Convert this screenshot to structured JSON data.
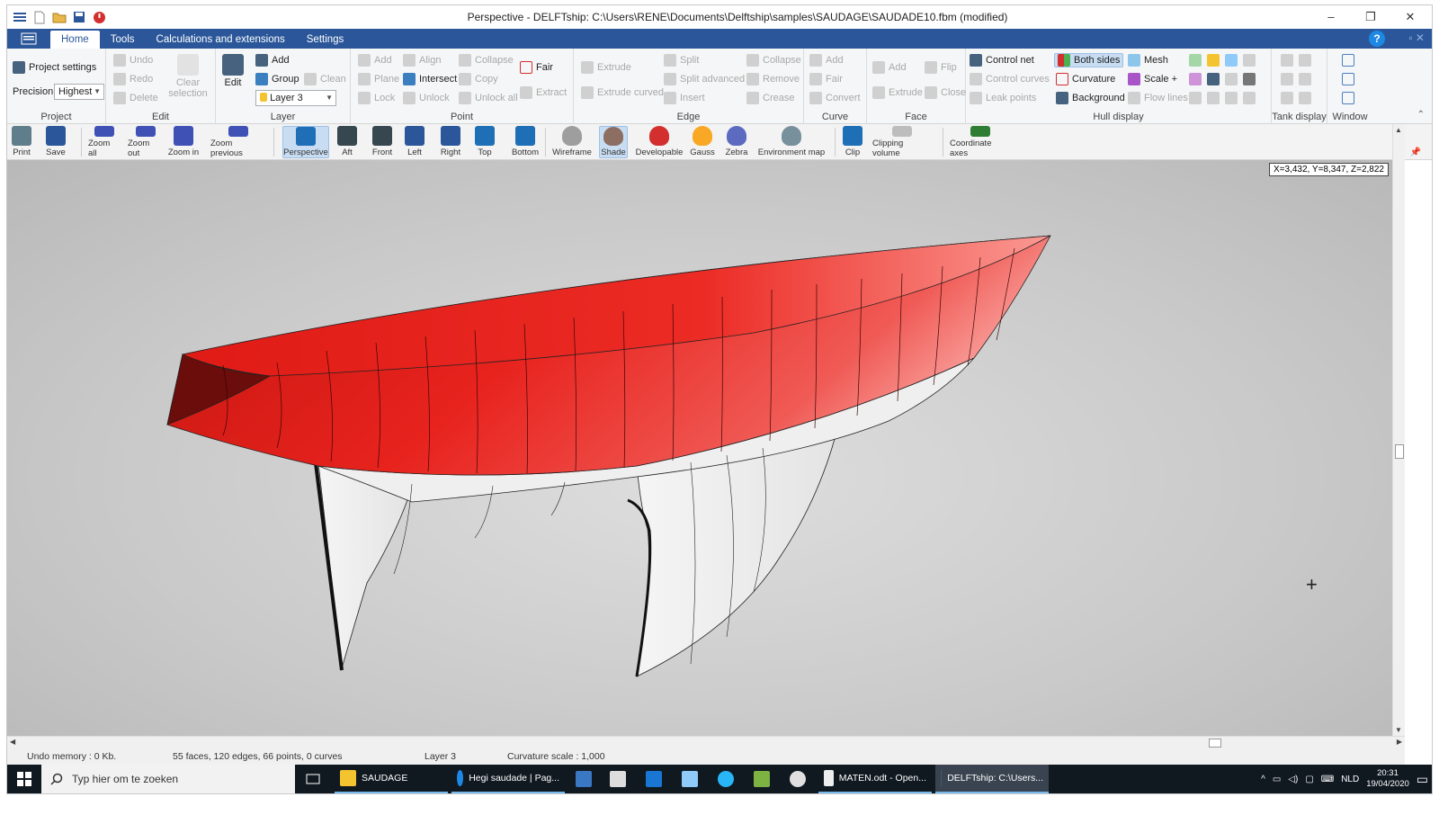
{
  "window": {
    "title": "Perspective - DELFTship: C:\\Users\\RENE\\Documents\\Delftship\\samples\\SAUDAGE\\SAUDADE10.fbm (modified)",
    "minimize": "–",
    "restore": "❐",
    "close": "✕"
  },
  "tabs": [
    "Home",
    "Tools",
    "Calculations and extensions",
    "Settings"
  ],
  "ribbon": {
    "project": {
      "label": "Project",
      "project_settings": "Project settings",
      "precision_label": "Precision",
      "precision_value": "Highest"
    },
    "edit": {
      "label": "Edit",
      "undo": "Undo",
      "redo": "Redo",
      "delete": "Delete",
      "clear_selection": "Clear selection"
    },
    "layer": {
      "label": "Layer",
      "edit": "Edit",
      "add": "Add",
      "group": "Group",
      "clean": "Clean",
      "current_layer": "Layer 3"
    },
    "point": {
      "label": "Point",
      "add": "Add",
      "align": "Align",
      "collapse": "Collapse",
      "fair": "Fair",
      "plane": "Plane",
      "intersect": "Intersect",
      "copy": "Copy",
      "lock": "Lock",
      "unlock": "Unlock",
      "unlock_all": "Unlock all",
      "extract": "Extract"
    },
    "edge": {
      "label": "Edge",
      "extrude": "Extrude",
      "split": "Split",
      "collapse": "Collapse",
      "split_advanced": "Split advanced",
      "remove": "Remove",
      "extrude_curved": "Extrude curved",
      "insert": "Insert",
      "crease": "Crease"
    },
    "curve": {
      "label": "Curve",
      "add": "Add",
      "fair": "Fair",
      "convert": "Convert"
    },
    "face": {
      "label": "Face",
      "add": "Add",
      "flip": "Flip",
      "extrude": "Extrude",
      "close": "Close"
    },
    "hull_display": {
      "label": "Hull display",
      "control_net": "Control net",
      "both_sides": "Both sides",
      "mesh": "Mesh",
      "control_curves": "Control curves",
      "curvature": "Curvature",
      "scale_plus": "Scale +",
      "leak_points": "Leak points",
      "background": "Background",
      "flow_lines": "Flow lines"
    },
    "tank_display": {
      "label": "Tank display"
    },
    "window_group": {
      "label": "Window"
    }
  },
  "viewbar": [
    {
      "label": "Print",
      "icon": "printer-icon"
    },
    {
      "label": "Save",
      "icon": "save-icon"
    },
    {
      "label": "Zoom all",
      "icon": "zoom-all-icon"
    },
    {
      "label": "Zoom out",
      "icon": "zoom-out-icon"
    },
    {
      "label": "Zoom in",
      "icon": "zoom-in-icon"
    },
    {
      "label": "Zoom previous",
      "icon": "zoom-previous-icon"
    },
    {
      "label": "Perspective",
      "icon": "perspective-icon"
    },
    {
      "label": "Aft",
      "icon": "aft-view-icon"
    },
    {
      "label": "Front",
      "icon": "front-view-icon"
    },
    {
      "label": "Left",
      "icon": "left-view-icon"
    },
    {
      "label": "Right",
      "icon": "right-view-icon"
    },
    {
      "label": "Top",
      "icon": "top-view-icon"
    },
    {
      "label": "Bottom",
      "icon": "bottom-view-icon"
    },
    {
      "label": "Wireframe",
      "icon": "wireframe-icon"
    },
    {
      "label": "Shade",
      "icon": "shade-icon"
    },
    {
      "label": "Developable",
      "icon": "developable-icon"
    },
    {
      "label": "Gauss",
      "icon": "gauss-icon"
    },
    {
      "label": "Zebra",
      "icon": "zebra-icon"
    },
    {
      "label": "Environment map",
      "icon": "environment-map-icon"
    },
    {
      "label": "Clip",
      "icon": "clip-icon"
    },
    {
      "label": "Clipping volume",
      "icon": "clipping-volume-icon"
    },
    {
      "label": "Coordinate axes",
      "icon": "coordinate-axes-icon"
    }
  ],
  "viewport": {
    "coordinates": "X=3,432, Y=8,347, Z=2,822",
    "hull_top_color": "#e8231e",
    "hull_bottom_color": "#f2f2f2"
  },
  "status": {
    "undo_memory": "Undo memory : 0 Kb.",
    "geometry": "55 faces, 120 edges, 66 points, 0 curves",
    "layer": "Layer 3",
    "curvature_scale": "Curvature scale : 1,000"
  },
  "taskbar": {
    "search_placeholder": "Typ hier om te zoeken",
    "items": [
      {
        "label": "SAUDAGE",
        "icon": "folder-icon"
      },
      {
        "label": "Hegi saudade | Pag...",
        "icon": "edge-browser-icon"
      },
      {
        "label": "MATEN.odt - Open...",
        "icon": "writer-icon"
      },
      {
        "label": "DELFTship: C:\\Users...",
        "icon": "delftship-icon"
      }
    ],
    "language": "NLD",
    "time": "20:31",
    "date": "19/04/2020"
  }
}
